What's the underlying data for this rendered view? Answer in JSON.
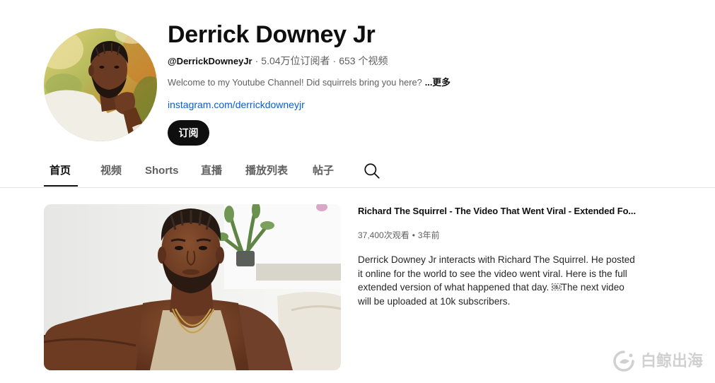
{
  "channel": {
    "name": "Derrick Downey Jr",
    "handle": "@DerrickDowneyJr",
    "meta_separator": "·",
    "subscribers": "5.04万位订阅者",
    "videos": "653 个视频",
    "description": "Welcome to my Youtube Channel! Did squirrels bring you here?",
    "more_label": "...更多",
    "link": "instagram.com/derrickdowneyjr",
    "subscribe_label": "订阅"
  },
  "tabs": [
    {
      "label": "首页",
      "selected": true
    },
    {
      "label": "视频",
      "selected": false
    },
    {
      "label": "Shorts",
      "selected": false
    },
    {
      "label": "直播",
      "selected": false
    },
    {
      "label": "播放列表",
      "selected": false
    },
    {
      "label": "帖子",
      "selected": false
    }
  ],
  "icons": {
    "search": "search-icon",
    "watermark_logo": "whale-logo-icon"
  },
  "featured_video": {
    "title": "Richard The Squirrel - The Video That Went Viral - Extended Fo...",
    "views": "37,400次观看",
    "bullet": "•",
    "age": "3年前",
    "description_lines": [
      "Derrick Downey Jr interacts with Richard The Squirrel. He posted",
      "it online for the world to see the video went viral. Here is the full",
      "extended version of what happened that day. ￼The next video",
      "will be uploaded at 10k subscribers."
    ]
  },
  "watermark": {
    "text": "白鲸出海"
  },
  "colors": {
    "primary": "#0f0f0f",
    "secondary": "#606060",
    "link": "#065fd4",
    "subscribe_bg": "#0f0f0f"
  }
}
